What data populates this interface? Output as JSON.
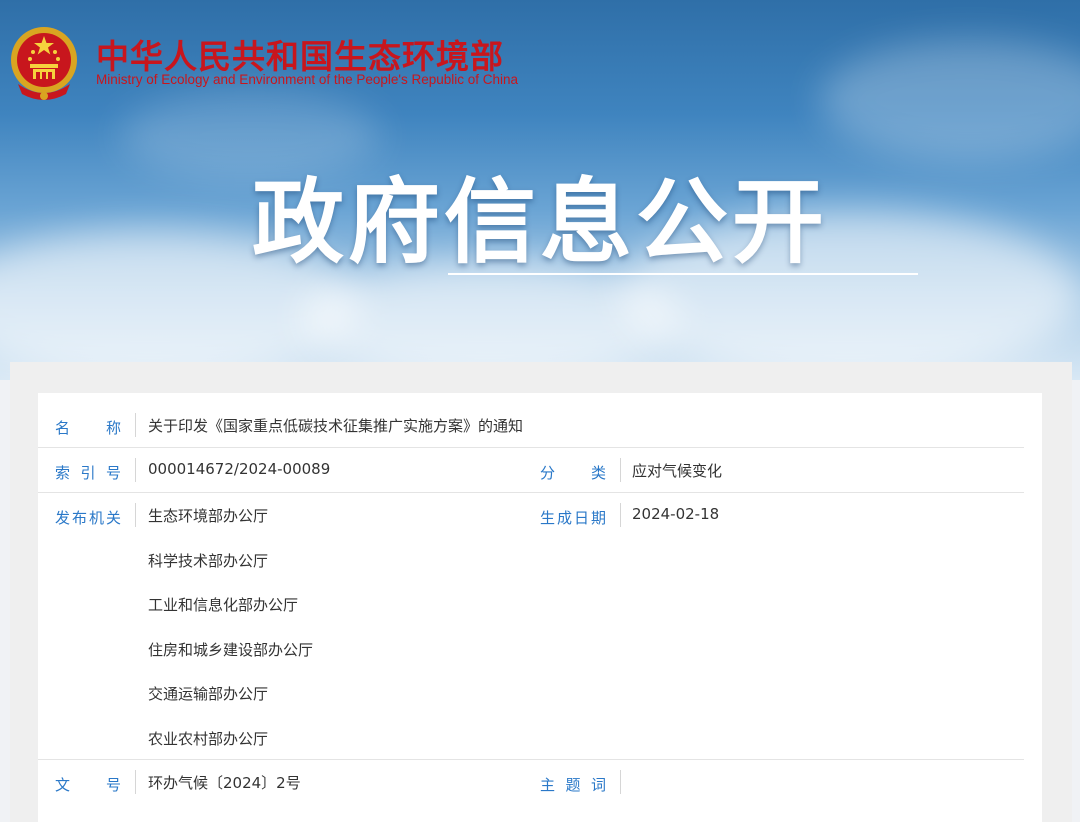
{
  "header": {
    "ministry_cn": "中华人民共和国生态环境部",
    "ministry_en": "Ministry of Ecology and Environment of the People's Republic of China",
    "banner_title": "政府信息公开"
  },
  "info": {
    "name_label": "名称",
    "name_value": "关于印发《国家重点低碳技术征集推广实施方案》的通知",
    "index_label": "索引号",
    "index_value": "000014672/2024-00089",
    "category_label": "分类",
    "category_value": "应对气候变化",
    "publisher_label": "发布机关",
    "publishers": [
      "生态环境部办公厅",
      "科学技术部办公厅",
      "工业和信息化部办公厅",
      "住房和城乡建设部办公厅",
      "交通运输部办公厅",
      "农业农村部办公厅"
    ],
    "date_label": "生成日期",
    "date_value": "2024-02-18",
    "docno_label": "文号",
    "docno_value": "环办气候〔2024〕2号",
    "keywords_label": "主题词",
    "keywords_value": ""
  },
  "colors": {
    "brand_red": "#c8161d",
    "label_blue": "#2a78c8"
  }
}
